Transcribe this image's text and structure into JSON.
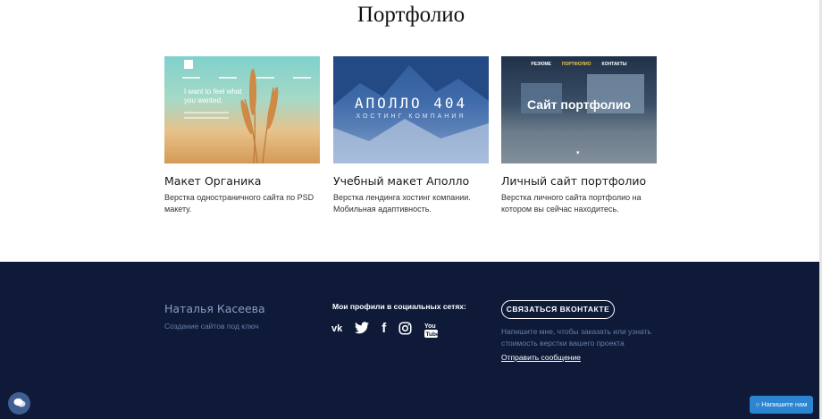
{
  "section": {
    "title": "Портфолио"
  },
  "cards": [
    {
      "title": "Макет Органика",
      "description": "Верстка одностраничного сайта по PSD макету.",
      "thumb_text": "I want to feel what you wanted.",
      "icon": "wheat-hero-image"
    },
    {
      "title": "Учебный макет Аполло",
      "description": "Верстка лендинга хостинг компании. Мобильная адаптивность.",
      "thumb_brand": "АПОЛЛО 404",
      "thumb_sub": "ХОСТИНГ КОМПАНИЯ"
    },
    {
      "title": "Личный сайт портфолио",
      "description": "Верстка личного сайта портфолио на котором вы сейчас находитесь.",
      "thumb_nav": [
        "РЕЗЮМЕ",
        "ПОРТФОЛИО",
        "КОНТАКТЫ"
      ],
      "thumb_head": "Сайт портфолио"
    }
  ],
  "footer": {
    "name": "Наталья Касеева",
    "tagline": "Создание сайтов под ключ",
    "socials_label": "Мои профили в социальных сетях:",
    "socials": [
      "vk-icon",
      "twitter-icon",
      "facebook-icon",
      "instagram-icon",
      "youtube-icon"
    ],
    "cta_button": "СВЯЗАТЬСЯ ВКОНТАКТЕ",
    "cta_note": "Напишите мне, чтобы заказать или узнать стоимость верстки вашего проекта",
    "send_link": "Отправить сообщение"
  },
  "widgets": {
    "write_us": "Напишите нам"
  },
  "colors": {
    "footer_bg": "#0e1a38",
    "accent": "#2b85d0"
  }
}
